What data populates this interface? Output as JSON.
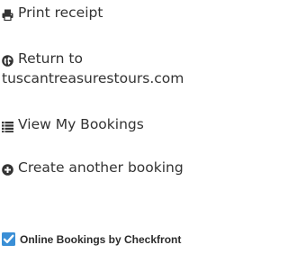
{
  "actions": {
    "print_label": "Print receipt",
    "return_label_line1": "Return to",
    "return_label_line2": "tuscantreasurestours.com",
    "view_label": "View My Bookings",
    "create_label": "Create another booking"
  },
  "footer": {
    "powered_label": "Online Bookings by Checkfront"
  },
  "icons": {
    "print": "print-icon",
    "globe": "globe-icon",
    "list": "list-icon",
    "plus": "plus-circle-icon",
    "checkfront": "checkfront-logo-icon"
  },
  "colors": {
    "text": "#333333",
    "checkfront_blue": "#3a8fd6"
  }
}
